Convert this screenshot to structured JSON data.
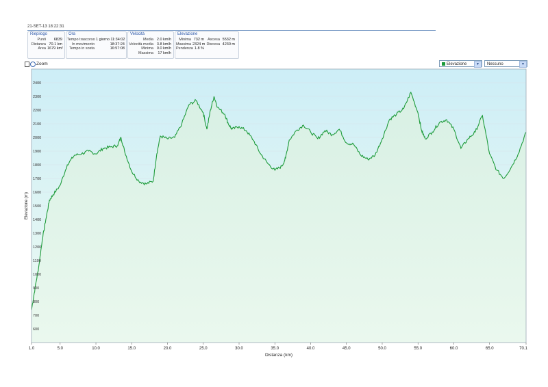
{
  "header": {
    "title": "21-SET-13 18:22:31"
  },
  "panels": {
    "riepilogo": {
      "title": "Riepilogo",
      "rows": [
        {
          "k": "Punti",
          "v": "6839"
        },
        {
          "k": "Distanza",
          "v": "70.1 km"
        },
        {
          "k": "Area",
          "v": "1679 km²"
        }
      ]
    },
    "ora": {
      "title": "Ora",
      "rows": [
        {
          "k": "Tempo trascorso",
          "v": "1 giorno 11:34:02"
        },
        {
          "k": "In movimento",
          "v": "18:37:24"
        },
        {
          "k": "Tempo in sosta",
          "v": "16:57:08"
        }
      ]
    },
    "velocita": {
      "title": "Velocità",
      "rows": [
        {
          "k": "Media",
          "v": "2.0 km/h"
        },
        {
          "k": "Velocità media",
          "v": "3.8 km/h"
        },
        {
          "k": "Minima",
          "v": "0.0 km/h"
        },
        {
          "k": "Massima",
          "v": "17 km/h"
        }
      ]
    },
    "elevazione": {
      "title": "Elevazione",
      "rows": [
        {
          "k": "Minima",
          "v": "732 m",
          "k2": "Ascesa",
          "v2": "5532 m"
        },
        {
          "k": "Massima",
          "v": "2324 m",
          "k2": "Discesa",
          "v2": "4230 m"
        },
        {
          "k": "Pendenza",
          "v": "1.8 %",
          "k2": "",
          "v2": ""
        }
      ]
    }
  },
  "toolbar": {
    "zoom_label": "Zoom",
    "series_select": "Elevazione",
    "overlay_select": "Nessuno"
  },
  "colors": {
    "line": "#1e9b3a",
    "fill_top": "#c9ecf3",
    "fill_bottom": "#ebf8ee",
    "grid": "#d7e2ea"
  },
  "chart_data": {
    "type": "area",
    "xlabel": "Distanza (km)",
    "ylabel": "Elevazione (m)",
    "xlim": [
      1.0,
      70.1
    ],
    "ylim": [
      500,
      2500
    ],
    "x_ticks": [
      "1.0",
      "5.0",
      "10.0",
      "15.0",
      "20.0",
      "25.0",
      "30.0",
      "35.0",
      "40.0",
      "45.0",
      "50.0",
      "55.0",
      "60.0",
      "65.0",
      "70.1"
    ],
    "y_ticks": [
      "600",
      "700",
      "800",
      "900",
      "1000",
      "1100",
      "1200",
      "1300",
      "1400",
      "1500",
      "1600",
      "1700",
      "1800",
      "1900",
      "2000",
      "2100",
      "2200",
      "2300",
      "2400"
    ],
    "grid": true,
    "legend": "Elevazione",
    "series": [
      {
        "x": [
          1.0,
          1.5,
          2.0,
          2.5,
          3.0,
          3.5,
          4.0,
          5.0,
          6.0,
          7.0,
          8.0,
          9.0,
          10.0,
          11.0,
          12.0,
          13.0,
          13.5,
          14.0,
          15.0,
          16.0,
          17.0,
          18.0,
          18.5,
          19.0,
          20.0,
          21.0,
          22.0,
          23.0,
          24.0,
          25.0,
          25.5,
          26.0,
          26.5,
          27.0,
          28.0,
          28.5,
          29.0,
          30.0,
          31.0,
          32.0,
          33.0,
          34.0,
          35.0,
          36.0,
          36.5,
          37.0,
          38.0,
          39.0,
          40.0,
          41.0,
          42.0,
          43.0,
          44.0,
          45.0,
          46.0,
          47.0,
          48.0,
          49.0,
          50.0,
          51.0,
          52.0,
          53.0,
          54.0,
          55.0,
          55.5,
          56.0,
          57.0,
          58.0,
          59.0,
          60.0,
          61.0,
          62.0,
          63.0,
          64.0,
          65.0,
          66.0,
          67.0,
          68.0,
          69.0,
          70.1
        ],
        "y": [
          740,
          900,
          1050,
          1250,
          1400,
          1540,
          1580,
          1650,
          1800,
          1870,
          1880,
          1900,
          1880,
          1920,
          1930,
          1940,
          2000,
          1900,
          1750,
          1680,
          1660,
          1680,
          1880,
          2010,
          1990,
          2000,
          2100,
          2240,
          2270,
          2180,
          2060,
          2200,
          2300,
          2220,
          2170,
          2100,
          2060,
          2080,
          2050,
          1980,
          1880,
          1810,
          1760,
          1790,
          1850,
          1980,
          2050,
          2090,
          2040,
          1990,
          2050,
          2020,
          2060,
          1960,
          1950,
          1870,
          1840,
          1870,
          1990,
          2130,
          2170,
          2210,
          2330,
          2180,
          2050,
          1990,
          2040,
          2110,
          2130,
          2060,
          1920,
          1990,
          2040,
          2160,
          1880,
          1760,
          1700,
          1780,
          1880,
          2040
        ]
      }
    ]
  }
}
